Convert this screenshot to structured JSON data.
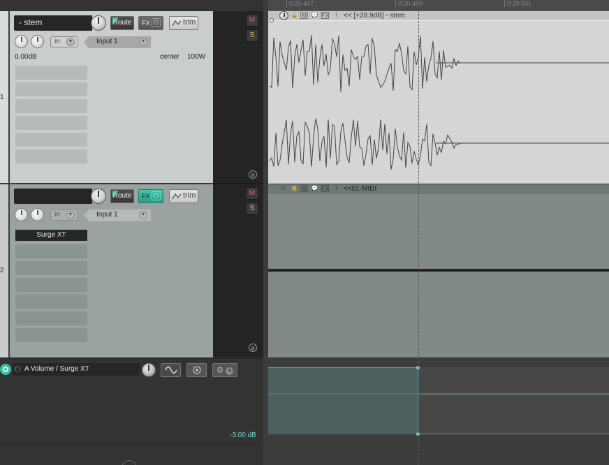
{
  "ruler": {
    "time_labels": [
      "0:20.497",
      "0:20.499",
      "0:20.501"
    ]
  },
  "tracks": [
    {
      "number": "1",
      "name": "- stem",
      "route_label": "Route",
      "fx_label": "FX",
      "trim_label": "trim",
      "in_label": "in",
      "in_fx_top": "IN",
      "in_fx_bottom": "FX",
      "input_label": "Input 1",
      "volume_text": "0.00dB",
      "pan_text": "center",
      "width_text": "100W",
      "mute_label": "M",
      "solo_label": "S",
      "fx_slots": []
    },
    {
      "number": "2",
      "name": "",
      "route_label": "Route",
      "fx_label": "FX",
      "trim_label": "trim",
      "in_label": "in",
      "in_fx_top": "IN",
      "in_fx_bottom": "FX",
      "input_label": "Input 1",
      "mute_label": "M",
      "solo_label": "S",
      "fx_slots": [
        "Surge XT"
      ]
    }
  ],
  "items": [
    {
      "label": "<< [+28.9dB] - stem"
    },
    {
      "label": "<<01-MIDI"
    }
  ],
  "envelope": {
    "name": "A Volume / Surge XT",
    "value_text": "-3.00 dB"
  },
  "colors": {
    "accent": "#35c1a6",
    "track1_bg": "#c9cdcd",
    "track2_bg": "#9aa2a2",
    "waveform_bg": "#d4d6d6",
    "midi_bg": "#818a88",
    "envelope_fill": "#4a5f5e",
    "envelope_line": "#4aa8a0"
  },
  "icons": {
    "fx_bypass": "power-icon",
    "trim_env": "envelope-icon",
    "phase": "phase-invert-icon",
    "env_active": "power-icon",
    "env_shape": "sine-icon",
    "env_settings": "gear-icon"
  }
}
